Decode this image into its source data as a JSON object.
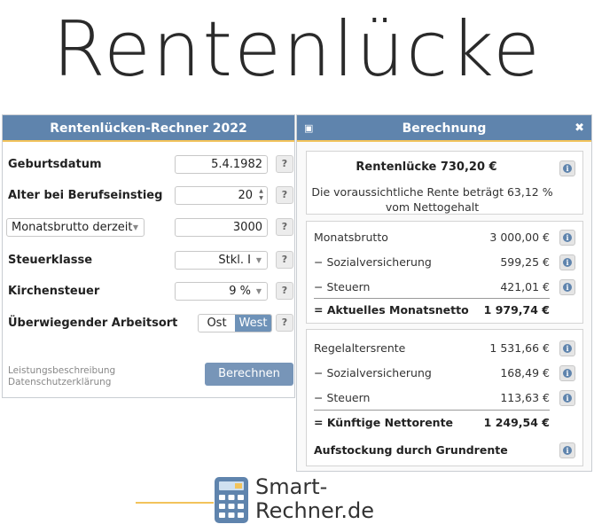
{
  "hero_title": "Rentenlücke",
  "left": {
    "title": "Rentenlücken-Rechner 2022",
    "birth_label": "Geburtsdatum",
    "birth_value": "5.4.1982",
    "age_label": "Alter bei Berufseinstieg",
    "age_value": "20",
    "income_select": "Monatsbrutto derzeit",
    "income_value": "3000",
    "tax_class_label": "Steuerklasse",
    "tax_class_value": "Stkl. I",
    "church_tax_label": "Kirchensteuer",
    "church_tax_value": "9 %",
    "workplace_label": "Überwiegender Arbeitsort",
    "workplace_options": [
      "Ost",
      "West"
    ],
    "help": "?",
    "link_1": "Leistungsbeschreibung",
    "link_2": "Datenschutzerklärung",
    "calc_button": "Berechnen"
  },
  "right": {
    "title": "Berechnung",
    "summary_title": "Rentenlücke 730,20 €",
    "summary_text": "Die voraussichtliche Rente beträgt 63,12 % vom Nettogehalt",
    "current": [
      {
        "label": "Monatsbrutto",
        "value": "3 000,00 €"
      },
      {
        "label": "− Sozialversicherung",
        "value": "599,25 €"
      },
      {
        "label": "− Steuern",
        "value": "421,01 €"
      }
    ],
    "current_total": {
      "label": "= Aktuelles Monatsnetto",
      "value": "1 979,74 €"
    },
    "future": [
      {
        "label": "Regelaltersrente",
        "value": "1 531,66 €"
      },
      {
        "label": "− Sozialversicherung",
        "value": "168,49 €"
      },
      {
        "label": "− Steuern",
        "value": "113,63 €"
      }
    ],
    "future_total": {
      "label": "= Künftige Nettorente",
      "value": "1 249,54 €"
    },
    "top_up": "Aufstockung durch Grundrente"
  },
  "logo": {
    "line1": "Smart-",
    "line2": "Rechner.de"
  },
  "colors": {
    "header": "#5f84ad",
    "accent": "#f2c35b",
    "button": "#7795b8"
  }
}
